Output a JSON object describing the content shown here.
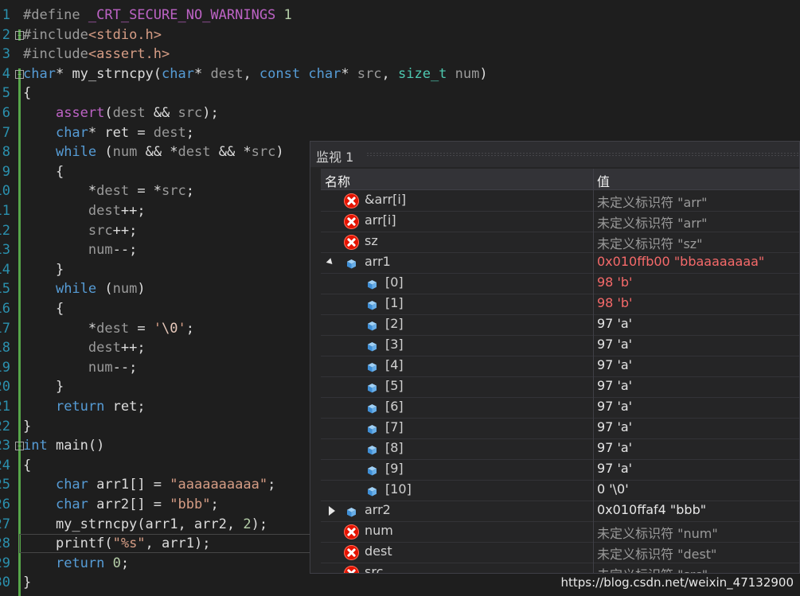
{
  "editor": {
    "lines": [
      {
        "n": "1",
        "segs": [
          [
            "pre",
            "#define "
          ],
          [
            "mac",
            "_CRT_SECURE_NO_WARNINGS"
          ],
          [
            "plain",
            " "
          ],
          [
            "num",
            "1"
          ]
        ]
      },
      {
        "n": "2",
        "fold": "−",
        "segs": [
          [
            "pre",
            "#include"
          ],
          [
            "inc",
            "<stdio.h>"
          ]
        ]
      },
      {
        "n": "3",
        "segs": [
          [
            "pre",
            "#include"
          ],
          [
            "inc",
            "<assert.h>"
          ]
        ]
      },
      {
        "n": "4",
        "fold": "−",
        "segs": [
          [
            "kw",
            "char"
          ],
          [
            "plain",
            "* "
          ],
          [
            "plain",
            "my_strncpy"
          ],
          [
            "plain",
            "("
          ],
          [
            "kw",
            "char"
          ],
          [
            "plain",
            "* "
          ],
          [
            "par",
            "dest"
          ],
          [
            "plain",
            ", "
          ],
          [
            "kw",
            "const"
          ],
          [
            "plain",
            " "
          ],
          [
            "kw",
            "char"
          ],
          [
            "plain",
            "* "
          ],
          [
            "par",
            "src"
          ],
          [
            "plain",
            ", "
          ],
          [
            "typ",
            "size_t"
          ],
          [
            "plain",
            " "
          ],
          [
            "par",
            "num"
          ],
          [
            "plain",
            ")"
          ]
        ]
      },
      {
        "n": "5",
        "segs": [
          [
            "plain",
            "{"
          ]
        ]
      },
      {
        "n": "6",
        "segs": [
          [
            "plain",
            "    "
          ],
          [
            "mac",
            "assert"
          ],
          [
            "plain",
            "("
          ],
          [
            "par",
            "dest"
          ],
          [
            "plain",
            " && "
          ],
          [
            "par",
            "src"
          ],
          [
            "plain",
            ");"
          ]
        ]
      },
      {
        "n": "7",
        "segs": [
          [
            "plain",
            "    "
          ],
          [
            "kw",
            "char"
          ],
          [
            "plain",
            "* ret = "
          ],
          [
            "par",
            "dest"
          ],
          [
            "plain",
            ";"
          ]
        ]
      },
      {
        "n": "8",
        "segs": [
          [
            "plain",
            "    "
          ],
          [
            "kw",
            "while"
          ],
          [
            "plain",
            " ("
          ],
          [
            "par",
            "num"
          ],
          [
            "plain",
            " && *"
          ],
          [
            "par",
            "dest"
          ],
          [
            "plain",
            " && *"
          ],
          [
            "par",
            "src"
          ],
          [
            "plain",
            ")"
          ]
        ]
      },
      {
        "n": "9",
        "segs": [
          [
            "plain",
            "    {"
          ]
        ]
      },
      {
        "n": "10",
        "segs": [
          [
            "plain",
            "        *"
          ],
          [
            "par",
            "dest"
          ],
          [
            "plain",
            " = *"
          ],
          [
            "par",
            "src"
          ],
          [
            "plain",
            ";"
          ]
        ]
      },
      {
        "n": "11",
        "segs": [
          [
            "plain",
            "        "
          ],
          [
            "par",
            "dest"
          ],
          [
            "plain",
            "++;"
          ]
        ]
      },
      {
        "n": "12",
        "segs": [
          [
            "plain",
            "        "
          ],
          [
            "par",
            "src"
          ],
          [
            "plain",
            "++;"
          ]
        ]
      },
      {
        "n": "13",
        "segs": [
          [
            "plain",
            "        "
          ],
          [
            "par",
            "num"
          ],
          [
            "plain",
            "--;"
          ]
        ]
      },
      {
        "n": "14",
        "segs": [
          [
            "plain",
            "    }"
          ]
        ]
      },
      {
        "n": "15",
        "segs": [
          [
            "plain",
            "    "
          ],
          [
            "kw",
            "while"
          ],
          [
            "plain",
            " ("
          ],
          [
            "par",
            "num"
          ],
          [
            "plain",
            ")"
          ]
        ]
      },
      {
        "n": "16",
        "segs": [
          [
            "plain",
            "    {"
          ]
        ]
      },
      {
        "n": "17",
        "segs": [
          [
            "plain",
            "        *"
          ],
          [
            "par",
            "dest"
          ],
          [
            "plain",
            " = "
          ],
          [
            "str",
            "'"
          ],
          [
            "esc",
            "\\0"
          ],
          [
            "str",
            "'"
          ],
          [
            "plain",
            ";"
          ]
        ]
      },
      {
        "n": "18",
        "segs": [
          [
            "plain",
            "        "
          ],
          [
            "par",
            "dest"
          ],
          [
            "plain",
            "++;"
          ]
        ]
      },
      {
        "n": "19",
        "segs": [
          [
            "plain",
            "        "
          ],
          [
            "par",
            "num"
          ],
          [
            "plain",
            "--;"
          ]
        ]
      },
      {
        "n": "20",
        "segs": [
          [
            "plain",
            "    }"
          ]
        ]
      },
      {
        "n": "21",
        "segs": [
          [
            "plain",
            "    "
          ],
          [
            "kw",
            "return"
          ],
          [
            "plain",
            " ret;"
          ]
        ]
      },
      {
        "n": "22",
        "segs": [
          [
            "plain",
            "}"
          ]
        ]
      },
      {
        "n": "23",
        "fold": "−",
        "segs": [
          [
            "kw",
            "int"
          ],
          [
            "plain",
            " main()"
          ]
        ]
      },
      {
        "n": "24",
        "segs": [
          [
            "plain",
            "{"
          ]
        ]
      },
      {
        "n": "25",
        "segs": [
          [
            "plain",
            "    "
          ],
          [
            "kw",
            "char"
          ],
          [
            "plain",
            " arr1[] = "
          ],
          [
            "str",
            "\"aaaaaaaaaa\""
          ],
          [
            "plain",
            ";"
          ]
        ]
      },
      {
        "n": "26",
        "segs": [
          [
            "plain",
            "    "
          ],
          [
            "kw",
            "char"
          ],
          [
            "plain",
            " arr2[] = "
          ],
          [
            "str",
            "\"bbb\""
          ],
          [
            "plain",
            ";"
          ]
        ]
      },
      {
        "n": "27",
        "segs": [
          [
            "plain",
            "    my_strncpy(arr1, arr2, "
          ],
          [
            "num",
            "2"
          ],
          [
            "plain",
            ");"
          ]
        ]
      },
      {
        "n": "28",
        "current": true,
        "segs": [
          [
            "plain",
            "    printf("
          ],
          [
            "str",
            "\"%s\""
          ],
          [
            "plain",
            ", arr1);"
          ]
        ]
      },
      {
        "n": "29",
        "segs": [
          [
            "plain",
            "    "
          ],
          [
            "kw",
            "return"
          ],
          [
            "plain",
            " "
          ],
          [
            "num",
            "0"
          ],
          [
            "plain",
            ";"
          ]
        ]
      },
      {
        "n": "30",
        "segs": [
          [
            "plain",
            "}"
          ]
        ]
      }
    ]
  },
  "watch": {
    "title": "监视 1",
    "col_name": "名称",
    "col_value": "值",
    "rows": [
      {
        "icon": "error",
        "indent": 0,
        "name": "&arr[i]",
        "value": "未定义标识符 \"arr\"",
        "vclass": "gray"
      },
      {
        "icon": "error",
        "indent": 0,
        "name": "arr[i]",
        "value": "未定义标识符 \"arr\"",
        "vclass": "gray"
      },
      {
        "icon": "error",
        "indent": 0,
        "name": "sz",
        "value": "未定义标识符 \"sz\"",
        "vclass": "gray"
      },
      {
        "icon": "cube",
        "indent": 0,
        "expander": "open",
        "name": "arr1",
        "value": "0x010ffb00 \"bbaaaaaaaa\"",
        "vclass": "red"
      },
      {
        "icon": "cube",
        "indent": 1,
        "name": "[0]",
        "value": "98 'b'",
        "vclass": "red"
      },
      {
        "icon": "cube",
        "indent": 1,
        "name": "[1]",
        "value": "98 'b'",
        "vclass": "red"
      },
      {
        "icon": "cube",
        "indent": 1,
        "name": "[2]",
        "value": "97 'a'",
        "vclass": "white"
      },
      {
        "icon": "cube",
        "indent": 1,
        "name": "[3]",
        "value": "97 'a'",
        "vclass": "white"
      },
      {
        "icon": "cube",
        "indent": 1,
        "name": "[4]",
        "value": "97 'a'",
        "vclass": "white"
      },
      {
        "icon": "cube",
        "indent": 1,
        "name": "[5]",
        "value": "97 'a'",
        "vclass": "white"
      },
      {
        "icon": "cube",
        "indent": 1,
        "name": "[6]",
        "value": "97 'a'",
        "vclass": "white"
      },
      {
        "icon": "cube",
        "indent": 1,
        "name": "[7]",
        "value": "97 'a'",
        "vclass": "white"
      },
      {
        "icon": "cube",
        "indent": 1,
        "name": "[8]",
        "value": "97 'a'",
        "vclass": "white"
      },
      {
        "icon": "cube",
        "indent": 1,
        "name": "[9]",
        "value": "97 'a'",
        "vclass": "white"
      },
      {
        "icon": "cube",
        "indent": 1,
        "name": "[10]",
        "value": "0 '\\0'",
        "vclass": "white"
      },
      {
        "icon": "cube",
        "indent": 0,
        "expander": "closed",
        "name": "arr2",
        "value": "0x010ffaf4 \"bbb\"",
        "vclass": "white"
      },
      {
        "icon": "error",
        "indent": 0,
        "name": "num",
        "value": "未定义标识符 \"num\"",
        "vclass": "gray"
      },
      {
        "icon": "error",
        "indent": 0,
        "name": "dest",
        "value": "未定义标识符 \"dest\"",
        "vclass": "gray"
      },
      {
        "icon": "error",
        "indent": 0,
        "name": "src",
        "value": "未定义标识符 \"src\"",
        "vclass": "gray"
      }
    ]
  },
  "watermark": "https://blog.csdn.net/weixin_47132900",
  "colors": {
    "keyword": "#569cd6",
    "macro": "#bd63c5",
    "string": "#d69d85",
    "type": "#4ec9b0",
    "param": "#9a9a9a",
    "changed_value": "#f66a6a",
    "error": "#e51400",
    "cube": "#68aee8"
  }
}
